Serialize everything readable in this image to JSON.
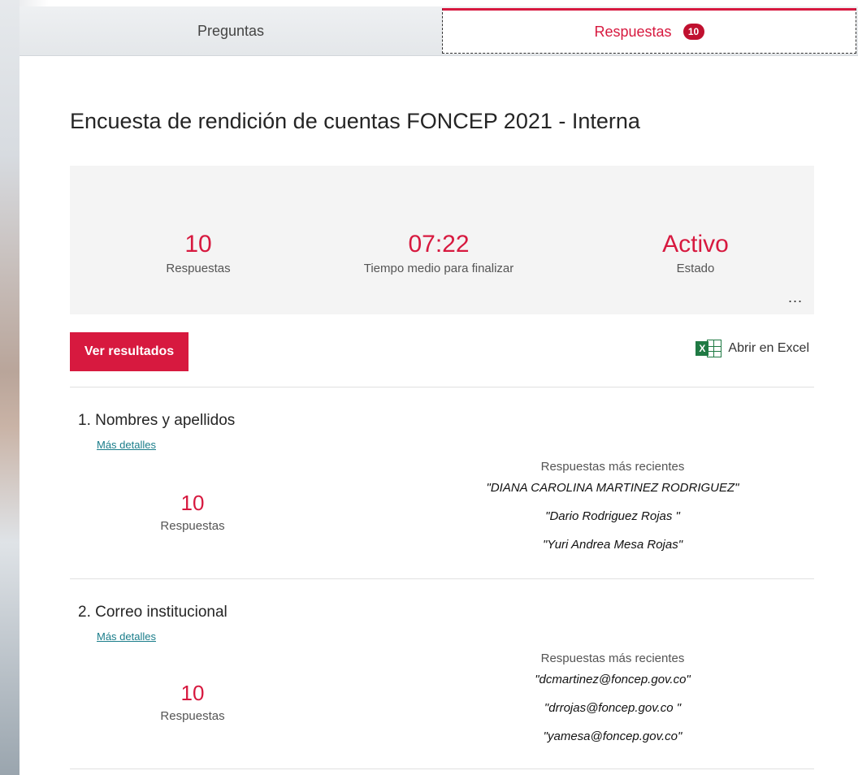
{
  "tabs": {
    "questions_label": "Preguntas",
    "responses_label": "Respuestas",
    "responses_badge": "10"
  },
  "form": {
    "title": "Encuesta de rendición de cuentas FONCEP 2021 - Interna"
  },
  "stats": {
    "responses": {
      "value": "10",
      "label": "Respuestas"
    },
    "avg_time": {
      "value": "07:22",
      "label": "Tiempo medio para finalizar"
    },
    "status": {
      "value": "Activo",
      "label": "Estado"
    },
    "more_label": "..."
  },
  "actions": {
    "view_results_label": "Ver resultados",
    "open_excel_label": "Abrir en Excel"
  },
  "questions": [
    {
      "number": "1.",
      "title": "Nombres y apellidos",
      "details_link": "Más detalles",
      "count": "10",
      "count_label": "Respuestas",
      "recent_header": "Respuestas más recientes",
      "recent": [
        "\"DIANA CAROLINA MARTINEZ RODRIGUEZ\"",
        "\"Dario Rodriguez Rojas \"",
        "\"Yuri Andrea Mesa Rojas\""
      ]
    },
    {
      "number": "2.",
      "title": "Correo institucional",
      "details_link": "Más detalles",
      "count": "10",
      "count_label": "Respuestas",
      "recent_header": "Respuestas más recientes",
      "recent": [
        "\"dcmartinez@foncep.gov.co\"",
        "\"drrojas@foncep.gov.co \"",
        "\"yamesa@foncep.gov.co\""
      ]
    }
  ],
  "colors": {
    "accent": "#d7193f",
    "link": "#1a7d8a",
    "excel_green": "#1f7a44"
  }
}
